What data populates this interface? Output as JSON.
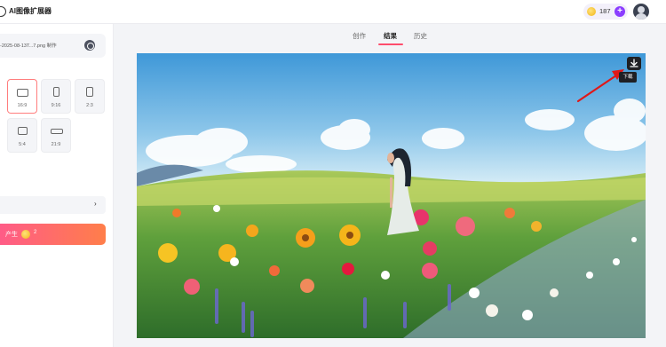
{
  "header": {
    "app_title": "AI图像扩展器",
    "credits": "187",
    "plus_label": "+"
  },
  "left_panel": {
    "file_name": "-2025-08-13T...7.png 制作",
    "ratios": [
      {
        "label": "16:9",
        "active": true
      },
      {
        "label": "9:16",
        "active": false
      },
      {
        "label": "2:3",
        "active": false
      },
      {
        "label": "5:4",
        "active": false
      },
      {
        "label": "21:9",
        "active": false
      }
    ],
    "generate": {
      "label": "产生",
      "cost": "2"
    }
  },
  "tabs": [
    {
      "label": "创作"
    },
    {
      "label": "结果",
      "active": true
    },
    {
      "label": "历史"
    }
  ],
  "result": {
    "download_tooltip": "下载"
  },
  "colors": {
    "accent": "#ff4d6d",
    "generate_start": "#ff5a8a",
    "generate_end": "#ff7e4a",
    "plus_button": "#8b3dff",
    "annotation_arrow": "#e01818"
  }
}
